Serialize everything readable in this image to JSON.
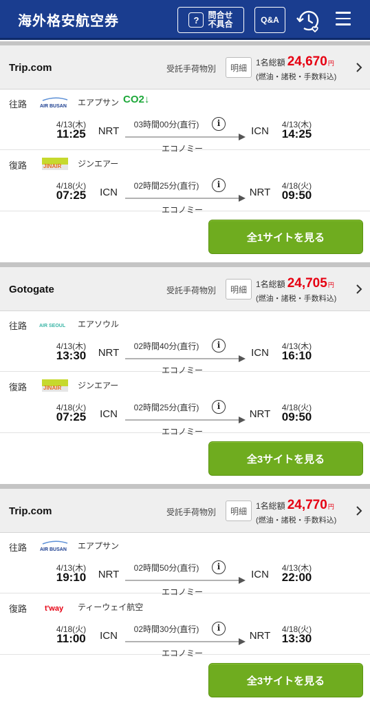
{
  "header": {
    "title": "海外格安航空券",
    "inquiry_label": "問合せ\n不具合",
    "inquiry_line1": "問合せ",
    "inquiry_line2": "不具合",
    "qa_label": "Q&A",
    "icons": [
      "question-icon",
      "history-heart-icon",
      "hamburger-menu-icon"
    ]
  },
  "colors": {
    "header": "#1a3d8f",
    "price": "#e60012",
    "cta": "#6fac1f",
    "co2": "#1ea83a"
  },
  "results": [
    {
      "provider": "Trip.com",
      "baggage": "受託手荷物別",
      "detail": "明細",
      "price_label": "1名総額",
      "price": "24,670",
      "yen": "円",
      "price_note": "(燃油・諸税・手数料込)",
      "cta": "全1サイトを見る",
      "legs": [
        {
          "direction": "往路",
          "logo": "AIR BUSAN",
          "airline": "エアプサン",
          "co2": "CO2↓",
          "dep_date": "4/13(木)",
          "dep_time": "11:25",
          "dep_airport": "NRT",
          "duration": "03時間00分(直行)",
          "cabin": "エコノミー",
          "arr_airport": "ICN",
          "arr_date": "4/13(木)",
          "arr_time": "14:25"
        },
        {
          "direction": "復路",
          "logo": "JINAIR",
          "airline": "ジンエアー",
          "co2": "",
          "dep_date": "4/18(火)",
          "dep_time": "07:25",
          "dep_airport": "ICN",
          "duration": "02時間25分(直行)",
          "cabin": "エコノミー",
          "arr_airport": "NRT",
          "arr_date": "4/18(火)",
          "arr_time": "09:50"
        }
      ]
    },
    {
      "provider": "Gotogate",
      "baggage": "受託手荷物別",
      "detail": "明細",
      "price_label": "1名総額",
      "price": "24,705",
      "yen": "円",
      "price_note": "(燃油・諸税・手数料込)",
      "cta": "全3サイトを見る",
      "legs": [
        {
          "direction": "往路",
          "logo": "AIR SEOUL",
          "airline": "エアソウル",
          "co2": "",
          "dep_date": "4/13(木)",
          "dep_time": "13:30",
          "dep_airport": "NRT",
          "duration": "02時間40分(直行)",
          "cabin": "エコノミー",
          "arr_airport": "ICN",
          "arr_date": "4/13(木)",
          "arr_time": "16:10"
        },
        {
          "direction": "復路",
          "logo": "JINAIR",
          "airline": "ジンエアー",
          "co2": "",
          "dep_date": "4/18(火)",
          "dep_time": "07:25",
          "dep_airport": "ICN",
          "duration": "02時間25分(直行)",
          "cabin": "エコノミー",
          "arr_airport": "NRT",
          "arr_date": "4/18(火)",
          "arr_time": "09:50"
        }
      ]
    },
    {
      "provider": "Trip.com",
      "baggage": "受託手荷物別",
      "detail": "明細",
      "price_label": "1名総額",
      "price": "24,770",
      "yen": "円",
      "price_note": "(燃油・諸税・手数料込)",
      "cta": "全3サイトを見る",
      "legs": [
        {
          "direction": "往路",
          "logo": "AIR BUSAN",
          "airline": "エアプサン",
          "co2": "",
          "dep_date": "4/13(木)",
          "dep_time": "19:10",
          "dep_airport": "NRT",
          "duration": "02時間50分(直行)",
          "cabin": "エコノミー",
          "arr_airport": "ICN",
          "arr_date": "4/13(木)",
          "arr_time": "22:00"
        },
        {
          "direction": "復路",
          "logo": "t'way",
          "airline": "ティーウェイ航空",
          "co2": "",
          "dep_date": "4/18(火)",
          "dep_time": "11:00",
          "dep_airport": "ICN",
          "duration": "02時間30分(直行)",
          "cabin": "エコノミー",
          "arr_airport": "NRT",
          "arr_date": "4/18(火)",
          "arr_time": "13:30"
        }
      ]
    }
  ]
}
